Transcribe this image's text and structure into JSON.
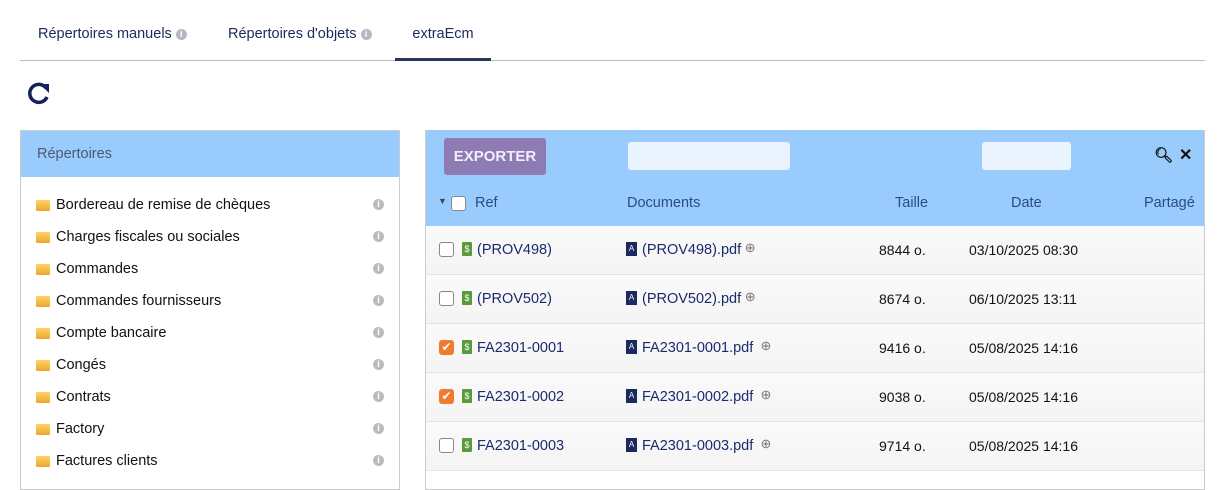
{
  "tabs": [
    {
      "label": "Répertoires manuels",
      "info": true
    },
    {
      "label": "Répertoires d'objets",
      "info": true
    },
    {
      "label": "extraEcm",
      "active": true
    }
  ],
  "left_panel": {
    "title": "Répertoires",
    "items": [
      "Bordereau de remise de chèques",
      "Charges fiscales ou sociales",
      "Commandes",
      "Commandes fournisseurs",
      "Compte bancaire",
      "Congés",
      "Contrats",
      "Factory",
      "Factures clients"
    ]
  },
  "toolbar": {
    "export_label": "EXPORTER"
  },
  "columns": {
    "ref": "Ref",
    "documents": "Documents",
    "size": "Taille",
    "date": "Date",
    "shared": "Partagé"
  },
  "rows": [
    {
      "ref": "(PROV498)",
      "doc": "(PROV498).pdf",
      "size": "8844 o.",
      "date": "03/10/2025 08:30",
      "checked": false
    },
    {
      "ref": "(PROV502)",
      "doc": "(PROV502).pdf",
      "size": "8674 o.",
      "date": "06/10/2025 13:11",
      "checked": false
    },
    {
      "ref": "FA2301-0001",
      "doc": "FA2301-0001.pdf",
      "size": "9416 o.",
      "date": "05/08/2025 14:16",
      "checked": true
    },
    {
      "ref": "FA2301-0002",
      "doc": "FA2301-0002.pdf",
      "size": "9038 o.",
      "date": "05/08/2025 14:16",
      "checked": true
    },
    {
      "ref": "FA2301-0003",
      "doc": "FA2301-0003.pdf",
      "size": "9714 o.",
      "date": "05/08/2025 14:16",
      "checked": false
    }
  ]
}
